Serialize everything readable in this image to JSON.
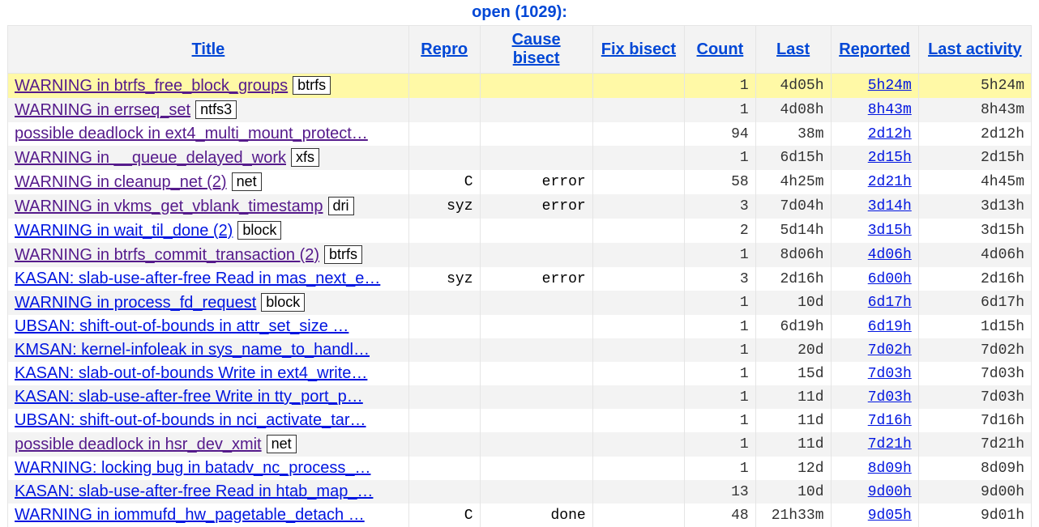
{
  "header": {
    "title": "open (1029):"
  },
  "columns": {
    "title": "Title",
    "repro": "Repro",
    "cause": "Cause bisect",
    "fix": "Fix bisect",
    "count": "Count",
    "last": "Last",
    "reported": "Reported",
    "activity": "Last activity"
  },
  "rows": [
    {
      "highlight": true,
      "visited": true,
      "title": "WARNING in btrfs_free_block_groups",
      "tag": "btrfs",
      "repro": "",
      "cause": "",
      "fix": "",
      "count": "1",
      "last": "4d05h",
      "reported": "5h24m",
      "activity": "5h24m"
    },
    {
      "visited": true,
      "title": "WARNING in errseq_set",
      "tag": "ntfs3",
      "repro": "",
      "cause": "",
      "fix": "",
      "count": "1",
      "last": "4d08h",
      "reported": "8h43m",
      "activity": "8h43m"
    },
    {
      "visited": true,
      "title": "possible deadlock in ext4_multi_mount_protect…",
      "tag": "",
      "repro": "",
      "cause": "",
      "fix": "",
      "count": "94",
      "last": "38m",
      "reported": "2d12h",
      "activity": "2d12h"
    },
    {
      "visited": true,
      "title": "WARNING in __queue_delayed_work",
      "tag": "xfs",
      "repro": "",
      "cause": "",
      "fix": "",
      "count": "1",
      "last": "6d15h",
      "reported": "2d15h",
      "activity": "2d15h"
    },
    {
      "visited": true,
      "title": "WARNING in cleanup_net (2)",
      "tag": "net",
      "repro": "C",
      "cause": "error",
      "fix": "",
      "count": "58",
      "last": "4h25m",
      "reported": "2d21h",
      "activity": "4h45m"
    },
    {
      "visited": true,
      "title": "WARNING in vkms_get_vblank_timestamp",
      "tag": "dri",
      "repro": "syz",
      "cause": "error",
      "fix": "",
      "count": "3",
      "last": "7d04h",
      "reported": "3d14h",
      "activity": "3d13h"
    },
    {
      "title": "WARNING in wait_til_done (2)",
      "tag": "block",
      "repro": "",
      "cause": "",
      "fix": "",
      "count": "2",
      "last": "5d14h",
      "reported": "3d15h",
      "activity": "3d15h"
    },
    {
      "visited": true,
      "title": "WARNING in btrfs_commit_transaction (2)",
      "tag": "btrfs",
      "repro": "",
      "cause": "",
      "fix": "",
      "count": "1",
      "last": "8d06h",
      "reported": "4d06h",
      "activity": "4d06h"
    },
    {
      "title": "KASAN: slab-use-after-free Read in mas_next_e…",
      "tag": "",
      "repro": "syz",
      "cause": "error",
      "fix": "",
      "count": "3",
      "last": "2d16h",
      "reported": "6d00h",
      "activity": "2d16h"
    },
    {
      "title": "WARNING in process_fd_request",
      "tag": "block",
      "repro": "",
      "cause": "",
      "fix": "",
      "count": "1",
      "last": "10d",
      "reported": "6d17h",
      "activity": "6d17h"
    },
    {
      "title": "UBSAN: shift-out-of-bounds in attr_set_size …",
      "tag": "",
      "repro": "",
      "cause": "",
      "fix": "",
      "count": "1",
      "last": "6d19h",
      "reported": "6d19h",
      "activity": "1d15h"
    },
    {
      "title": "KMSAN: kernel-infoleak in sys_name_to_handl…",
      "tag": "",
      "repro": "",
      "cause": "",
      "fix": "",
      "count": "1",
      "last": "20d",
      "reported": "7d02h",
      "activity": "7d02h"
    },
    {
      "title": "KASAN: slab-out-of-bounds Write in ext4_write…",
      "tag": "",
      "repro": "",
      "cause": "",
      "fix": "",
      "count": "1",
      "last": "15d",
      "reported": "7d03h",
      "activity": "7d03h"
    },
    {
      "title": "KASAN: slab-use-after-free Write in tty_port_p…",
      "tag": "",
      "repro": "",
      "cause": "",
      "fix": "",
      "count": "1",
      "last": "11d",
      "reported": "7d03h",
      "activity": "7d03h"
    },
    {
      "title": "UBSAN: shift-out-of-bounds in nci_activate_tar…",
      "tag": "",
      "repro": "",
      "cause": "",
      "fix": "",
      "count": "1",
      "last": "11d",
      "reported": "7d16h",
      "activity": "7d16h"
    },
    {
      "visited": true,
      "title": "possible deadlock in hsr_dev_xmit",
      "tag": "net",
      "repro": "",
      "cause": "",
      "fix": "",
      "count": "1",
      "last": "11d",
      "reported": "7d21h",
      "activity": "7d21h"
    },
    {
      "title": "WARNING: locking bug in batadv_nc_process_…",
      "tag": "",
      "repro": "",
      "cause": "",
      "fix": "",
      "count": "1",
      "last": "12d",
      "reported": "8d09h",
      "activity": "8d09h"
    },
    {
      "title": "KASAN: slab-use-after-free Read in htab_map_…",
      "tag": "",
      "repro": "",
      "cause": "",
      "fix": "",
      "count": "13",
      "last": "10d",
      "reported": "9d00h",
      "activity": "9d00h"
    },
    {
      "title": "WARNING in iommufd_hw_pagetable_detach …",
      "tag": "",
      "repro": "C",
      "cause": "done",
      "fix": "",
      "count": "48",
      "last": "21h33m",
      "reported": "9d05h",
      "activity": "9d01h"
    }
  ]
}
